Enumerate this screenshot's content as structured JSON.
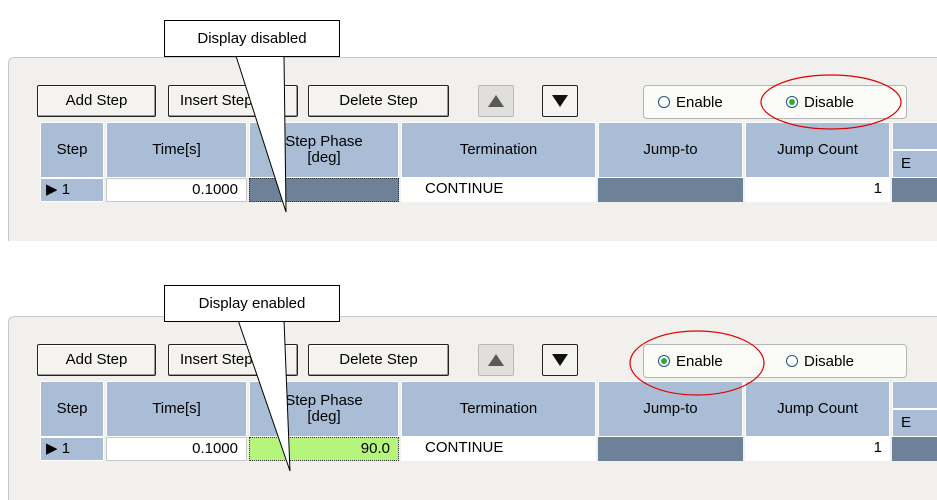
{
  "panels": [
    {
      "callout": "Display disabled",
      "buttons": {
        "add_step": "Add Step",
        "insert_step": "Insert Step",
        "delete_step": "Delete Step"
      },
      "radio": {
        "enable_label": "Enable",
        "disable_label": "Disable",
        "selected": "Disable"
      },
      "columns": [
        "Step",
        "Time[s]",
        "Step Phase\n[deg]",
        "Termination",
        "Jump-to",
        "Jump Count"
      ],
      "extra_col_partial": "E",
      "row": {
        "step": "1",
        "time": "0.1000",
        "phase": "",
        "termination": "CONTINUE",
        "jump_count": "1"
      }
    },
    {
      "callout": "Display enabled",
      "buttons": {
        "add_step": "Add Step",
        "insert_step": "Insert Step",
        "delete_step": "Delete Step"
      },
      "radio": {
        "enable_label": "Enable",
        "disable_label": "Disable",
        "selected": "Enable"
      },
      "columns": [
        "Step",
        "Time[s]",
        "Step Phase\n[deg]",
        "Termination",
        "Jump-to",
        "Jump Count"
      ],
      "extra_col_partial": "E",
      "row": {
        "step": "1",
        "time": "0.1000",
        "phase": "90.0",
        "termination": "CONTINUE",
        "jump_count": "1"
      }
    }
  ],
  "colors": {
    "header_blue": "#a9bed6",
    "disabled_cell": "#6d8198",
    "enabled_cell": "#b6f57c",
    "highlight_ellipse": "#e00000",
    "radio_dot": "#2faa2f"
  }
}
